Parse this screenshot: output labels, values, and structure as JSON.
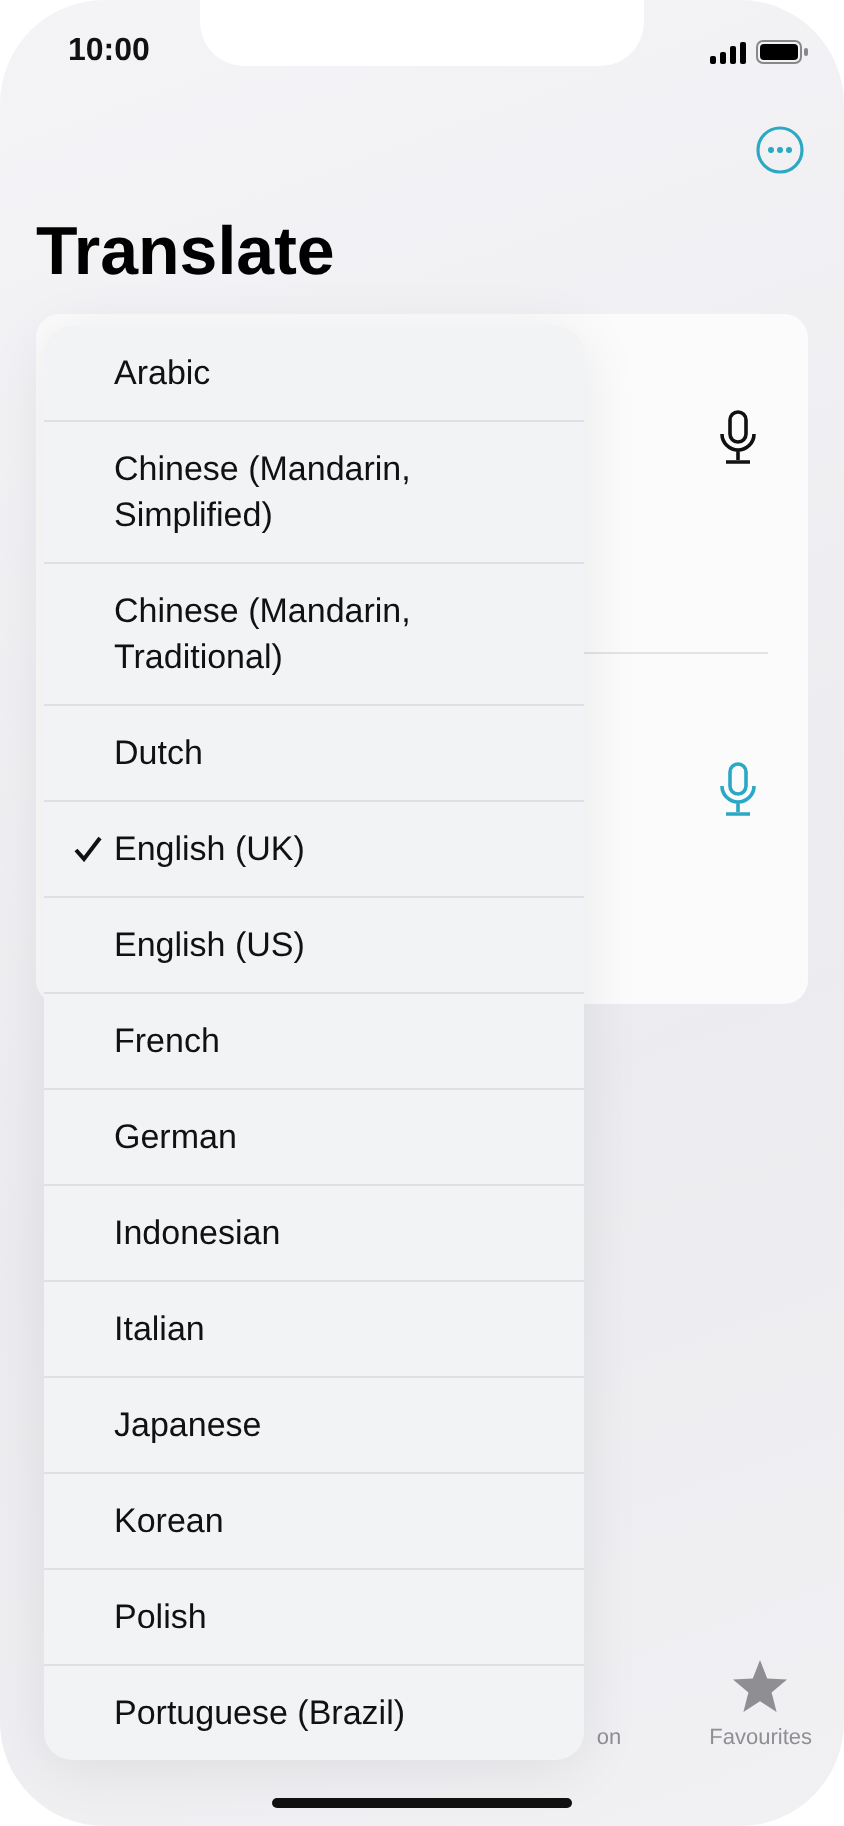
{
  "status_bar": {
    "time": "10:00"
  },
  "title": "Translate",
  "input_panels": [
    {
      "active": false
    },
    {
      "active": true
    }
  ],
  "languages": [
    {
      "label": "Arabic",
      "selected": false
    },
    {
      "label": "Chinese (Mandarin, Simplified)",
      "selected": false
    },
    {
      "label": "Chinese (Mandarin, Traditional)",
      "selected": false
    },
    {
      "label": "Dutch",
      "selected": false
    },
    {
      "label": "English (UK)",
      "selected": true
    },
    {
      "label": "English (US)",
      "selected": false
    },
    {
      "label": "French",
      "selected": false
    },
    {
      "label": "German",
      "selected": false
    },
    {
      "label": "Indonesian",
      "selected": false
    },
    {
      "label": "Italian",
      "selected": false
    },
    {
      "label": "Japanese",
      "selected": false
    },
    {
      "label": "Korean",
      "selected": false
    },
    {
      "label": "Polish",
      "selected": false
    },
    {
      "label": "Portuguese (Brazil)",
      "selected": false
    }
  ],
  "tab_bar": [
    {
      "label": "on",
      "kind": "hidden"
    },
    {
      "label": "Favourites",
      "kind": "star"
    }
  ]
}
